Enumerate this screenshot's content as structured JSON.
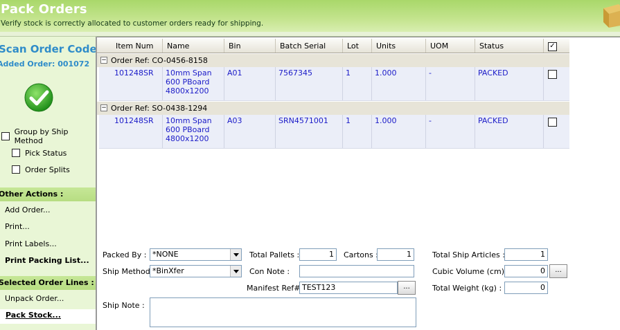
{
  "header": {
    "title": "Pack Orders",
    "subtitle": "Verify stock is correctly allocated to customer orders ready for shipping."
  },
  "sidebar": {
    "scan_label": "Scan Order Code:",
    "added_order": "Added Order: 001072",
    "options": [
      {
        "label": "Group by Ship Method",
        "checked": false
      },
      {
        "label": "Pick Status",
        "checked": false
      },
      {
        "label": "Order Splits",
        "checked": false
      }
    ],
    "other_actions_title": "Other Actions :",
    "other_actions": [
      "Add Order...",
      "Print...",
      "Print Labels...",
      "Print Packing List..."
    ],
    "selected_title": "Selected Order Lines :",
    "selected_actions": [
      "Unpack Order...",
      "Pack Stock..."
    ]
  },
  "grid": {
    "columns": [
      "Item Num",
      "Name",
      "Bin",
      "Batch Serial",
      "Lot",
      "Units",
      "UOM",
      "Status"
    ],
    "groups": [
      {
        "ref": "Order Ref: CO-0456-8158",
        "rows": [
          {
            "item_num": "101248SR",
            "name": "10mm Span 600 PBoard 4800x1200",
            "bin": "A01",
            "batch_serial": "7567345",
            "lot": "1",
            "units": "1.000",
            "uom": "-",
            "status": "PACKED",
            "checked": false
          }
        ]
      },
      {
        "ref": "Order Ref: SO-0438-1294",
        "rows": [
          {
            "item_num": "101248SR",
            "name": "10mm Span 600 PBoard 4800x1200",
            "bin": "A03",
            "batch_serial": "SRN4571001",
            "lot": "1",
            "units": "1.000",
            "uom": "-",
            "status": "PACKED",
            "checked": false
          }
        ]
      }
    ]
  },
  "form": {
    "packed_by_label": "Packed By :",
    "packed_by": "*NONE",
    "ship_method_label": "Ship Method :",
    "ship_method": "*BinXfer",
    "ship_note_label": "Ship Note :",
    "ship_note": "",
    "total_pallets_label": "Total Pallets :",
    "total_pallets": "1",
    "cartons_label": "Cartons :",
    "cartons": "1",
    "con_note_label": "Con Note :",
    "con_note": "",
    "manifest_label": "Manifest Ref# :",
    "manifest": "TEST123",
    "total_ship_articles_label": "Total Ship Articles :",
    "total_ship_articles": "1",
    "cubic_volume_label": "Cubic Volume (cm) :",
    "cubic_volume": "0",
    "total_weight_label": "Total Weight (kg) :",
    "total_weight": "0",
    "ellipsis": "..."
  },
  "colors": {
    "header_green": "#a9d86a",
    "sidebar_bg": "#e9f6d6",
    "scan_blue": "#2f8cc9",
    "cell_text": "#1a1ac8",
    "row_bg": "#ebeef8",
    "group_bg": "#e7e4d8"
  },
  "icons": {
    "header": "box-icon",
    "scan_status": "check-icon",
    "expander": "collapse-icon"
  }
}
